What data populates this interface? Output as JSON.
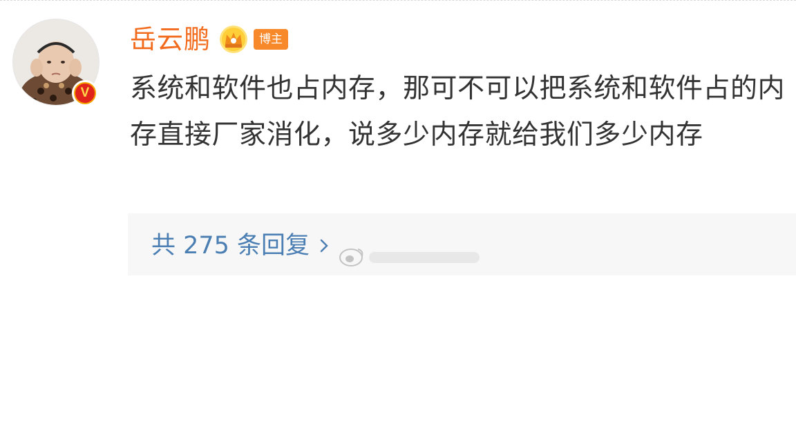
{
  "post": {
    "author": "岳云鹏",
    "role_badge": "博主",
    "content": "系统和软件也占内存，那可不可以把系统和软件占的内存直接厂家消化，说多少内存就给我们多少内存"
  },
  "replies": {
    "label": "共 275 条回复"
  },
  "icons": {
    "verified": "verified-v-icon",
    "crown": "crown-icon",
    "chevron": "chevron-right-icon",
    "watermark": "weibo-logo-icon"
  },
  "colors": {
    "username": "#f26a1b",
    "badge_bg": "#f7892b",
    "link": "#4b7fb3",
    "reply_bg": "#f7f7f7",
    "verified_red": "#e0241b",
    "verified_gold": "#f4a300"
  }
}
